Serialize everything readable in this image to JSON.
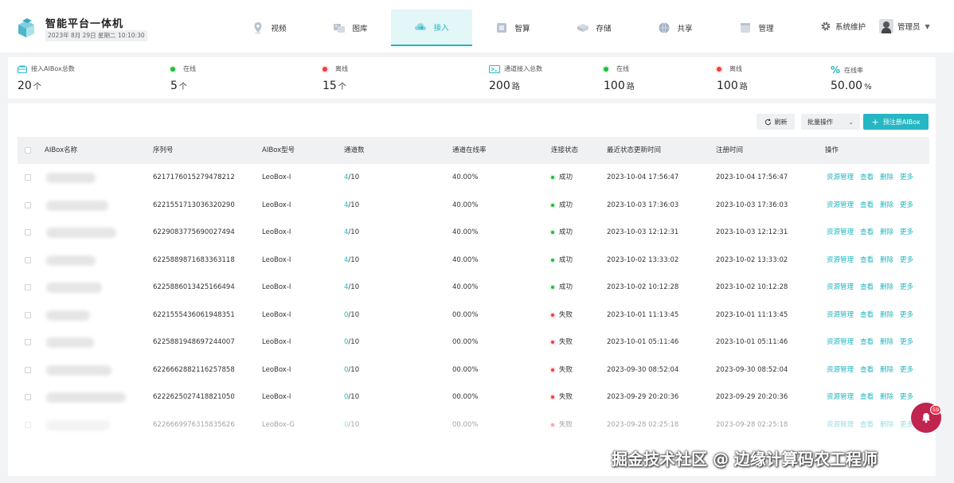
{
  "header": {
    "app_title": "智能平台一体机",
    "date_text": "2023年 8月 29日  星期二  10:10:30",
    "nav": [
      {
        "label": "视频",
        "icon": "map-pin-icon"
      },
      {
        "label": "图库",
        "icon": "image-gallery-icon"
      },
      {
        "label": "接入",
        "icon": "cloud-access-icon"
      },
      {
        "label": "智算",
        "icon": "compute-icon"
      },
      {
        "label": "存储",
        "icon": "storage-icon"
      },
      {
        "label": "共享",
        "icon": "share-globe-icon"
      },
      {
        "label": "管理",
        "icon": "manage-icon"
      }
    ],
    "active_nav": "接入",
    "settings_label": "系统维护",
    "user_label": "管理员"
  },
  "stats": [
    {
      "label": "接入AIBox总数",
      "value": "20",
      "unit": "个",
      "icon": "box-icon"
    },
    {
      "label": "在线",
      "value": "5",
      "unit": "个",
      "icon": "online-dot"
    },
    {
      "label": "离线",
      "value": "15",
      "unit": "个",
      "icon": "offline-dot"
    },
    {
      "label": "通道接入总数",
      "value": "200",
      "unit": "路",
      "icon": "channel-icon"
    },
    {
      "label": "在线",
      "value": "100",
      "unit": "路",
      "icon": "online-dot"
    },
    {
      "label": "离线",
      "value": "100",
      "unit": "路",
      "icon": "offline-dot"
    },
    {
      "label": "在线率",
      "value": "50.00",
      "unit": "%",
      "icon": "percent-icon"
    }
  ],
  "toolbar": {
    "refresh_label": "刷新",
    "batch_label": "批量操作",
    "register_label": "预注册AIBox"
  },
  "table": {
    "columns": [
      "AIBox名称",
      "序列号",
      "AIBox型号",
      "通道数",
      "通道在线率",
      "连接状态",
      "最近状态更新时间",
      "注册时间",
      "操作"
    ],
    "actions": [
      "资源管理",
      "查看",
      "删除",
      "更多"
    ],
    "rows": [
      {
        "serial": "6217176015279478212",
        "model": "LeoBox-I",
        "ch_online": "4",
        "ch_total": "/10",
        "rate": "40.00%",
        "status": "成功",
        "status_ok": true,
        "updated": "2023-10-04 17:56:47",
        "registered": "2023-10-04 17:56:47"
      },
      {
        "serial": "6221551713036320290",
        "model": "LeoBox-I",
        "ch_online": "4",
        "ch_total": "/10",
        "rate": "40.00%",
        "status": "成功",
        "status_ok": true,
        "updated": "2023-10-03 17:36:03",
        "registered": "2023-10-03 17:36:03"
      },
      {
        "serial": "6229083775690027494",
        "model": "LeoBox-I",
        "ch_online": "4",
        "ch_total": "/10",
        "rate": "40.00%",
        "status": "成功",
        "status_ok": true,
        "updated": "2023-10-03 12:12:31",
        "registered": "2023-10-03 12:12:31"
      },
      {
        "serial": "6225889871683363118",
        "model": "LeoBox-I",
        "ch_online": "4",
        "ch_total": "/10",
        "rate": "40.00%",
        "status": "成功",
        "status_ok": true,
        "updated": "2023-10-02 13:33:02",
        "registered": "2023-10-02 13:33:02"
      },
      {
        "serial": "6225886013425166494",
        "model": "LeoBox-I",
        "ch_online": "4",
        "ch_total": "/10",
        "rate": "40.00%",
        "status": "成功",
        "status_ok": true,
        "updated": "2023-10-02 10:12:28",
        "registered": "2023-10-02 10:12:28"
      },
      {
        "serial": "6221555436061948351",
        "model": "LeoBox-I",
        "ch_online": "0",
        "ch_total": "/10",
        "rate": "00.00%",
        "status": "失败",
        "status_ok": false,
        "updated": "2023-10-01 11:13:45",
        "registered": "2023-10-01 11:13:45"
      },
      {
        "serial": "6225881948697244007",
        "model": "LeoBox-I",
        "ch_online": "0",
        "ch_total": "/10",
        "rate": "00.00%",
        "status": "失败",
        "status_ok": false,
        "updated": "2023-10-01 05:11:46",
        "registered": "2023-10-01 05:11:46"
      },
      {
        "serial": "6226662882116257858",
        "model": "LeoBox-I",
        "ch_online": "0",
        "ch_total": "/10",
        "rate": "00.00%",
        "status": "失败",
        "status_ok": false,
        "updated": "2023-09-30 08:52:04",
        "registered": "2023-09-30 08:52:04"
      },
      {
        "serial": "6222625027418821050",
        "model": "LeoBox-I",
        "ch_online": "0",
        "ch_total": "/10",
        "rate": "00.00%",
        "status": "失败",
        "status_ok": false,
        "updated": "2023-09-29 20:20:36",
        "registered": "2023-09-29 20:20:36"
      },
      {
        "serial": "6226669976315835626",
        "model": "LeoBox-G",
        "ch_online": "0",
        "ch_total": "/10",
        "rate": "00.00%",
        "status": "失败",
        "status_ok": false,
        "updated": "2023-09-28 02:25:18",
        "registered": "2023-09-28 02:25:18"
      }
    ]
  },
  "notification_count": "59",
  "watermark": "掘金技术社区 @ 边缘计算码农工程师",
  "colors": {
    "accent": "#21b6c1",
    "success": "#1fbd3a",
    "danger": "#f23c3c",
    "bell": "#c0244f"
  }
}
